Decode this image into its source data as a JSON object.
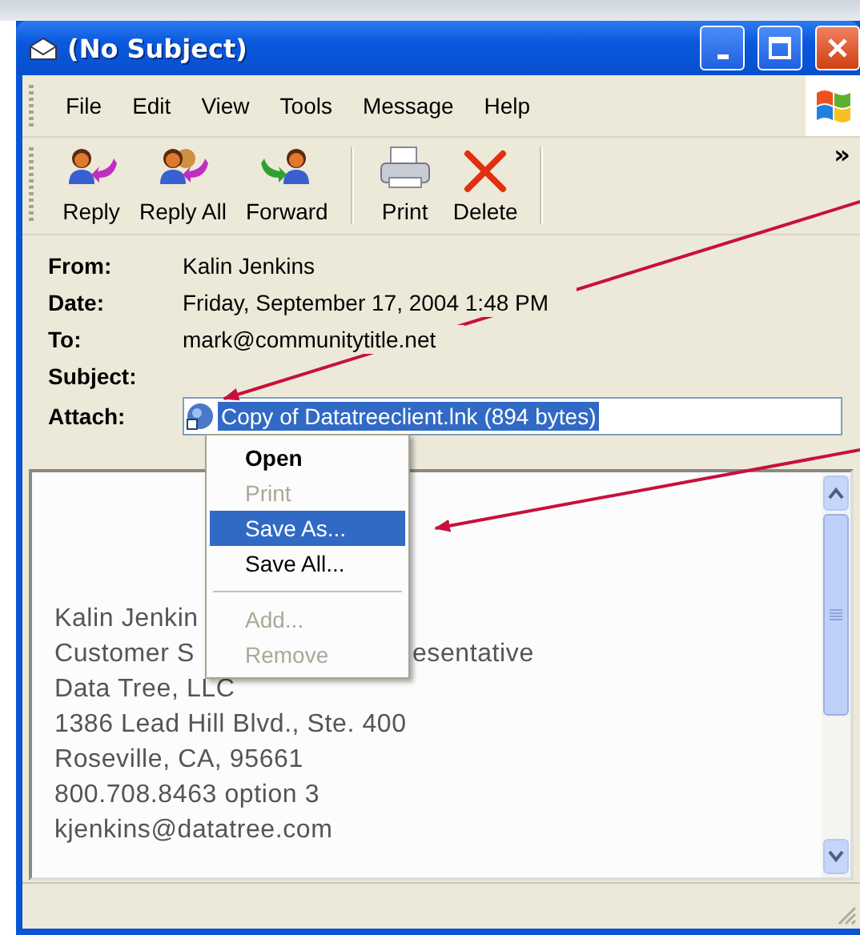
{
  "window": {
    "title": "(No Subject)"
  },
  "menu_bar": [
    "File",
    "Edit",
    "View",
    "Tools",
    "Message",
    "Help"
  ],
  "toolbar": {
    "buttons": [
      {
        "kind": "reply",
        "label": "Reply"
      },
      {
        "kind": "reply_all",
        "label": "Reply All"
      },
      {
        "kind": "forward",
        "label": "Forward"
      },
      {
        "kind": "print",
        "label": "Print"
      },
      {
        "kind": "delete",
        "label": "Delete"
      }
    ],
    "chevron": "»"
  },
  "header": [
    {
      "label": "From:",
      "value": "Kalin Jenkins"
    },
    {
      "label": "Date:",
      "value": "Friday, September 17, 2004 1:48 PM"
    },
    {
      "label": "To:",
      "value": "mark@communitytitle.net"
    },
    {
      "label": "Subject:"
    },
    {
      "label": "Attach:",
      "attachment": "Copy of Datatreeclient.lnk (894 bytes)",
      "selected": true
    }
  ],
  "context_menu": [
    {
      "kind": "item",
      "label": "Open",
      "default": true,
      "disabled": false,
      "selected": false
    },
    {
      "kind": "item",
      "label": "Print",
      "default": false,
      "disabled": true,
      "selected": false
    },
    {
      "kind": "item",
      "label": "Save As...",
      "default": false,
      "disabled": false,
      "selected": true
    },
    {
      "kind": "item",
      "label": "Save All...",
      "default": false,
      "disabled": false,
      "selected": false
    },
    {
      "kind": "separator"
    },
    {
      "kind": "item",
      "label": "Add...",
      "default": false,
      "disabled": true,
      "selected": false
    },
    {
      "kind": "item",
      "label": "Remove",
      "default": false,
      "disabled": true,
      "selected": false
    }
  ],
  "body_lines": [
    {
      "text": "Kalin Jenkin"
    },
    {
      "text": "Customer S",
      "rest": "esentative"
    },
    {
      "text": "Data Tree, LLC"
    },
    {
      "text": "1386 Lead Hill Blvd., Ste. 400"
    },
    {
      "text": "Roseville, CA, 95661"
    },
    {
      "text": "800.708.8463 option 3"
    },
    {
      "text": "kjenkins@datatree.com"
    }
  ]
}
